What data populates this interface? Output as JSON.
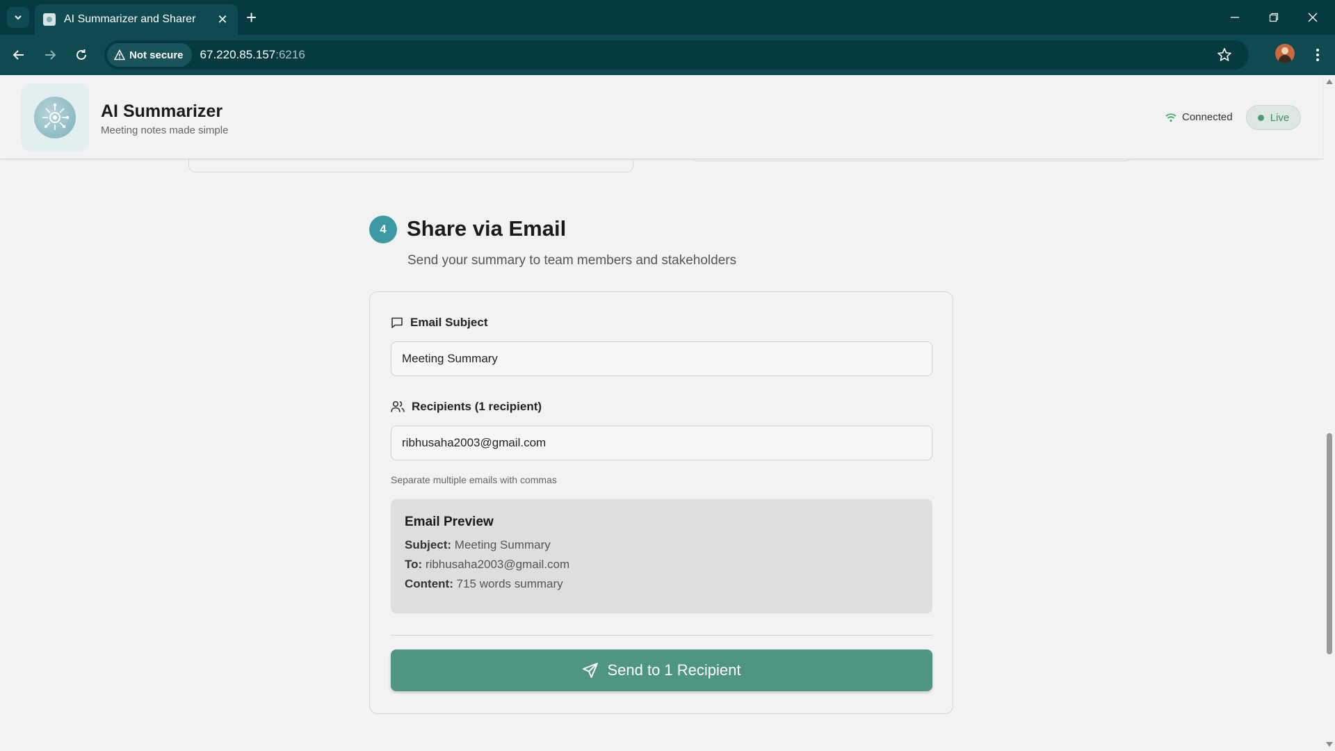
{
  "browser": {
    "tab_title": "AI Summarizer and Sharer",
    "security_label": "Not secure",
    "url_host": "67.220.85.157",
    "url_port": ":6216"
  },
  "header": {
    "title": "AI Summarizer",
    "subtitle": "Meeting notes made simple",
    "connection_status": "Connected",
    "live_label": "Live"
  },
  "section": {
    "step_number": "4",
    "title": "Share via Email",
    "subtitle": "Send your summary to team members and stakeholders"
  },
  "form": {
    "subject_label": "Email Subject",
    "subject_value": "Meeting Summary",
    "recipients_label": "Recipients (1 recipient)",
    "recipients_value": "ribhusaha2003@gmail.com",
    "recipients_hint": "Separate multiple emails with commas"
  },
  "preview": {
    "title": "Email Preview",
    "subject_key": "Subject:",
    "subject_value": "Meeting Summary",
    "to_key": "To:",
    "to_value": "ribhusaha2003@gmail.com",
    "content_key": "Content:",
    "content_value": "715 words summary"
  },
  "send_button_label": "Send to 1 Recipient",
  "colors": {
    "browser_dark": "#063a40",
    "browser_toolbar": "#0f4a51",
    "accent_teal": "#3d9aa5",
    "send_button": "#4e9682",
    "live_green": "#3f8c6b"
  }
}
